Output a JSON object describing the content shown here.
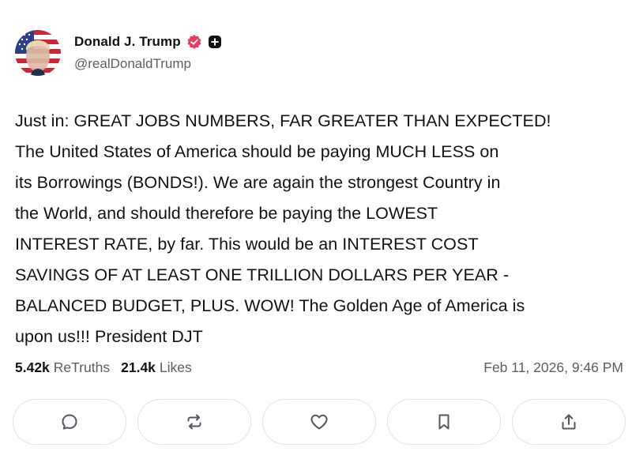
{
  "author": {
    "display_name": "Donald J. Trump",
    "handle": "@realDonaldTrump",
    "verified_icon": "verified-badge-icon",
    "plus_icon": "plus-badge-icon",
    "verified_color": "#e0405e"
  },
  "post": {
    "text": "Just in: GREAT JOBS NUMBERS, FAR GREATER THAN EXPECTED!\nThe United States of America should be paying MUCH LESS on\nits Borrowings (BONDS!). We are again the strongest Country in\nthe World, and should therefore be paying the LOWEST\nINTEREST RATE, by far. This would be an INTEREST COST\nSAVINGS OF AT LEAST ONE TRILLION DOLLARS PER YEAR -\nBALANCED BUDGET, PLUS. WOW! The Golden Age of America is\nupon us!!! President DJT"
  },
  "stats": {
    "retruths_count": "5.42k",
    "retruths_label": "ReTruths",
    "likes_count": "21.4k",
    "likes_label": "Likes",
    "timestamp": "Feb 11, 2026, 9:46 PM"
  },
  "actions": [
    {
      "icon": "reply-icon"
    },
    {
      "icon": "retruth-icon"
    },
    {
      "icon": "like-heart-icon"
    },
    {
      "icon": "bookmark-icon"
    },
    {
      "icon": "share-icon"
    }
  ]
}
